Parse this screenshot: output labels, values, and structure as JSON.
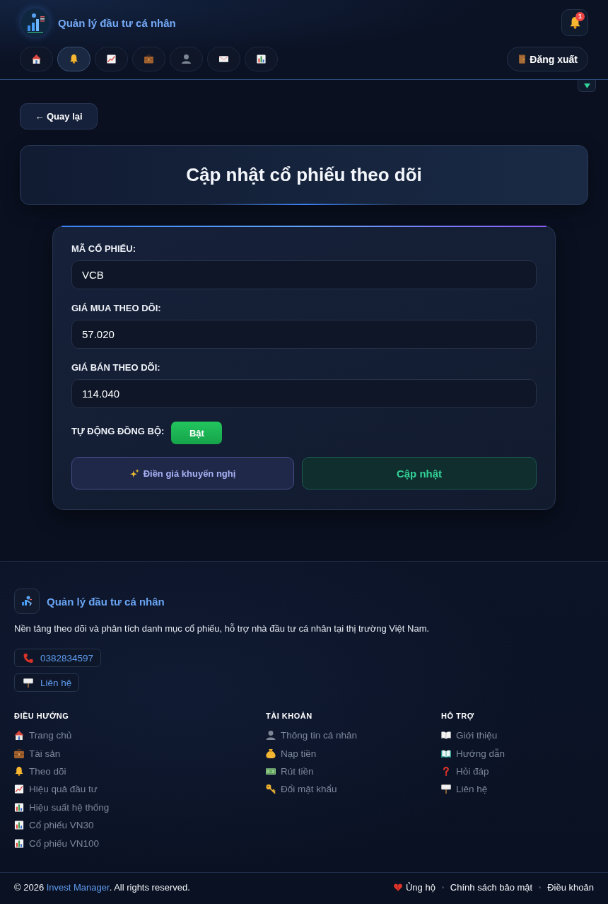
{
  "header": {
    "app_title": "Quản lý đầu tư cá nhân",
    "notifications": {
      "count": "1"
    },
    "nav": [
      {
        "selected": false
      },
      {
        "selected": true
      },
      {
        "selected": false
      },
      {
        "selected": false
      },
      {
        "selected": false
      },
      {
        "selected": false
      },
      {
        "selected": false
      }
    ],
    "logout": "Đăng xuất"
  },
  "dropdown": {
    "expanded": false
  },
  "back_button": "← Quay lại",
  "page_title": "Cập nhật cổ phiếu theo dõi",
  "form": {
    "fields": [
      {
        "label": "MÃ CỔ PHIẾU:",
        "value": "VCB"
      },
      {
        "label": "GIÁ MUA THEO DÕI:",
        "value": "57.020"
      },
      {
        "label": "GIÁ BÁN THEO DÕI:",
        "value": "114.040"
      }
    ],
    "auto_sync": {
      "label": "TỰ ĐỘNG ĐỒNG BỘ:",
      "on": true,
      "state_text": "Bật"
    },
    "buttons": [
      {
        "kind": "secondary",
        "label": "Điền giá khuyến nghị"
      },
      {
        "kind": "primary",
        "label": "Cập nhật"
      }
    ]
  },
  "footer": {
    "brand": "Quản lý đầu tư cá nhân",
    "description": "Nền tảng theo dõi và phân tích danh mục cổ phiếu, hỗ trợ nhà đầu tư cá nhân tại thị trường Việt Nam.",
    "contacts": [
      {
        "kind": "phone",
        "label": "0382834597"
      },
      {
        "kind": "contact",
        "label": "Liên hệ"
      }
    ],
    "columns": [
      {
        "title": "ĐIỀU HƯỚNG",
        "items": [
          "Trang chủ",
          "Tài sản",
          "Theo dõi",
          "Hiệu quả đầu tư",
          "Hiệu suất hệ thống",
          "Cổ phiếu VN30",
          "Cổ phiếu VN100"
        ]
      },
      {
        "title": "TÀI KHOẢN",
        "items": [
          "Thông tin cá nhân",
          "Nạp tiền",
          "Rút tiền",
          "Đổi mật khẩu"
        ]
      },
      {
        "title": "HỖ TRỢ",
        "items": [
          "Giới thiệu",
          "Hướng dẫn",
          "Hỏi đáp",
          "Liên hệ"
        ]
      }
    ],
    "copyright": {
      "prefix": "© 2026 ",
      "brand": "Invest Manager",
      "suffix": ". All rights reserved."
    },
    "links": [
      {
        "kind": "support",
        "label": "Ủng hộ"
      },
      {
        "kind": "plain",
        "label": "Chính sách bảo mật"
      },
      {
        "kind": "plain",
        "label": "Điều khoản"
      }
    ]
  }
}
